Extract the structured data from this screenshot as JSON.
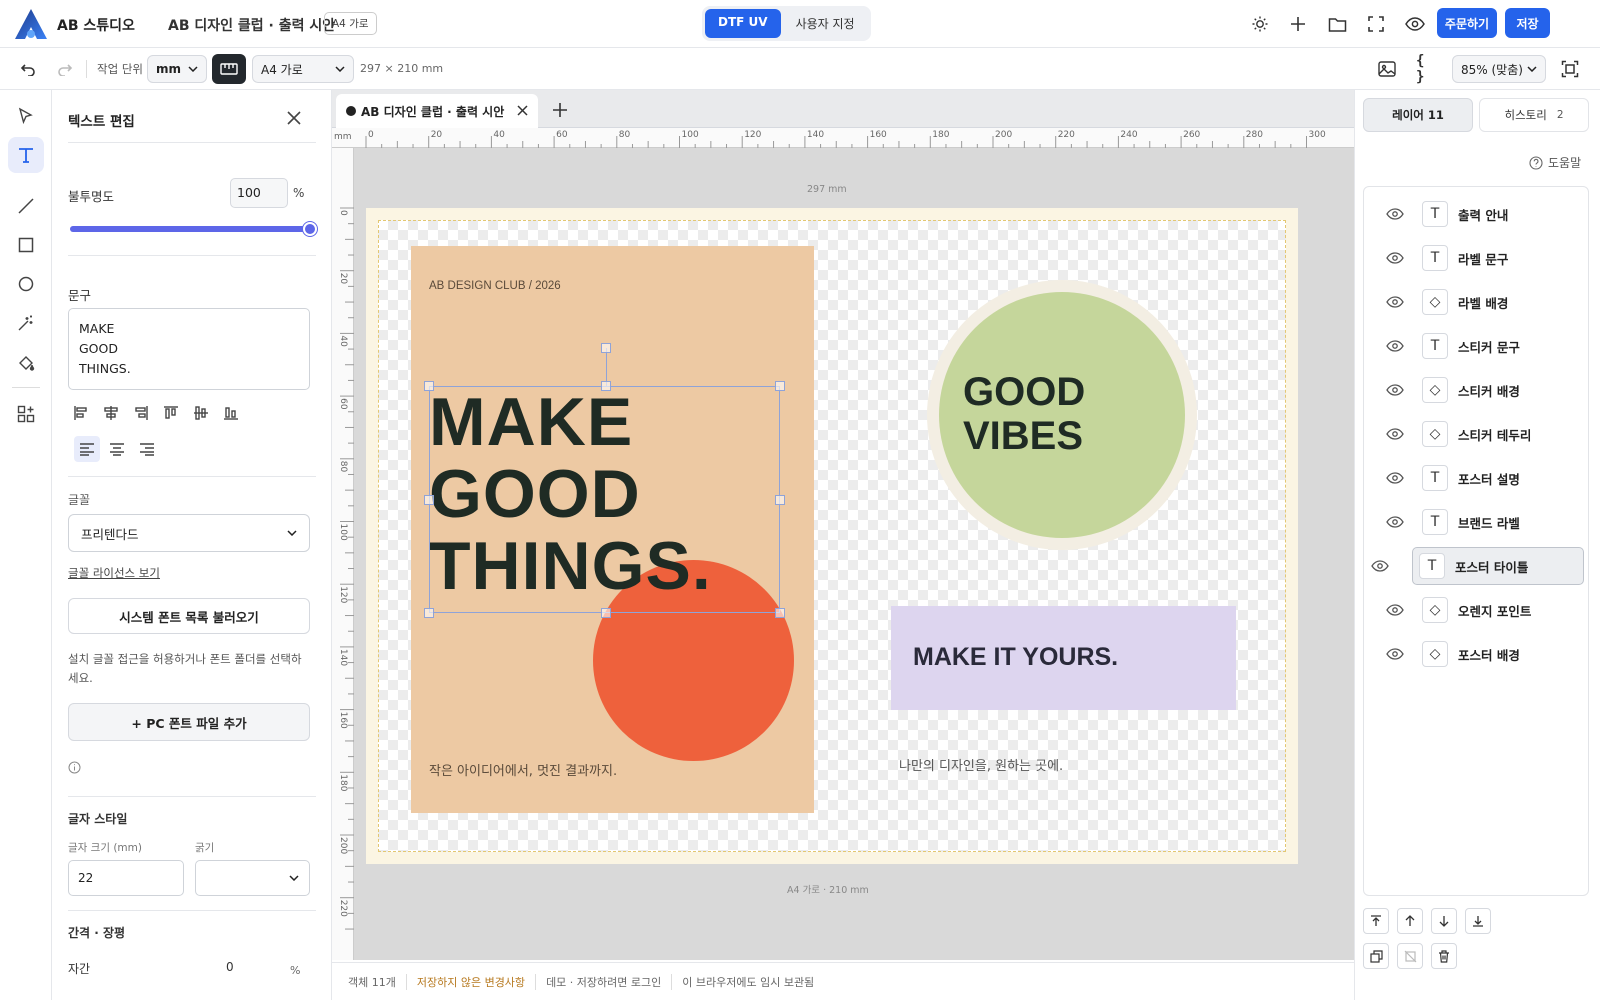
{
  "app": {
    "name": "AB 스튜디오",
    "doc_title": "AB 디자인 클럽 · 출력 시안",
    "size_badge": "A4 가로"
  },
  "mode_toggle": {
    "options": [
      "DTF UV",
      "사용자 지정"
    ],
    "selected": "DTF UV"
  },
  "top_actions": {
    "order_label": "주문하기",
    "save_label": "저장"
  },
  "toolbar": {
    "unit_label": "작업 단위",
    "unit_value": "mm",
    "page_value": "A4 가로",
    "page_dims": "297 × 210 mm",
    "zoom_value": "85% (맞춤)"
  },
  "panel": {
    "title": "텍스트 편집",
    "opacity_label": "불투명도",
    "opacity_value": "100",
    "opacity_unit": "%",
    "opacity_level": 1.0,
    "text_label": "문구",
    "text_lines": [
      "MAKE",
      "GOOD",
      "THINGS."
    ],
    "font_label": "글꼴",
    "font_value": "프리텐다드",
    "font_license": "글꼴 라이선스 보기",
    "load_system_fonts": "시스템 폰트 목록 불러오기",
    "font_help": "설치 글꼴 접근을 허용하거나 폰트 폴더를 선택하세요.",
    "add_pc_font": "+ PC 폰트 파일 추가",
    "style_label": "글자 스타일",
    "size_label": "글자 크기 (mm)",
    "size_value": "22",
    "weight_label": "굵기",
    "spacing_label": "간격 · 장평",
    "tracking_label": "자간",
    "tracking_value": "0",
    "tracking_unit": "%"
  },
  "tab": {
    "label": "AB 디자인 클럽 · 출력 시안"
  },
  "ruler": {
    "unit": "mm",
    "h_ticks": [
      "0",
      "20",
      "40",
      "60",
      "80",
      "100",
      "120",
      "140",
      "160",
      "180",
      "200",
      "220",
      "240",
      "260",
      "280",
      "300"
    ],
    "v_ticks": [
      "0",
      "20",
      "40",
      "60",
      "80",
      "100",
      "120",
      "140",
      "160",
      "180",
      "200",
      "220"
    ]
  },
  "canvas": {
    "width_label": "297 mm",
    "bottom_label": "A4 가로 · 210 mm",
    "poster_brand": "AB DESIGN CLUB / 2026",
    "poster_title": [
      "MAKE",
      "GOOD",
      "THINGS."
    ],
    "poster_caption": "작은 아이디어에서, 멋진 결과까지.",
    "sticker_text": [
      "GOOD",
      "VIBES"
    ],
    "label_text": "MAKE IT YOURS.",
    "note_text": "나만의 디자인을, 원하는 곳에.",
    "colors": {
      "poster_bg": "#edc9a3",
      "orange": "#ee613c",
      "green": "#c5d69b",
      "sticker_border": "#f3eee3",
      "label_bg": "#ddd5ef",
      "dark_text": "#1f2b24"
    }
  },
  "right": {
    "layers_tab": "레이어 11",
    "history_tab": "히스토리",
    "history_count": "2",
    "help_label": "도움말",
    "layers": [
      {
        "name": "출력 안내",
        "kind": "T"
      },
      {
        "name": "라벨 문구",
        "kind": "T"
      },
      {
        "name": "라벨 배경",
        "kind": "◇"
      },
      {
        "name": "스티커 문구",
        "kind": "T"
      },
      {
        "name": "스티커 배경",
        "kind": "◇"
      },
      {
        "name": "스티커 테두리",
        "kind": "◇"
      },
      {
        "name": "포스터 설명",
        "kind": "T"
      },
      {
        "name": "브랜드 라벨",
        "kind": "T"
      },
      {
        "name": "포스터 타이틀",
        "kind": "T",
        "selected": true
      },
      {
        "name": "오렌지 포인트",
        "kind": "◇"
      },
      {
        "name": "포스터 배경",
        "kind": "◇"
      }
    ]
  },
  "status": {
    "objects": "객체 11개",
    "unsaved": "저장하지 않은 변경사항",
    "demo": "데모 · 저장하려면 로그인",
    "local": "이 브라우저에도 임시 보관됨"
  },
  "accent": "#2563eb"
}
